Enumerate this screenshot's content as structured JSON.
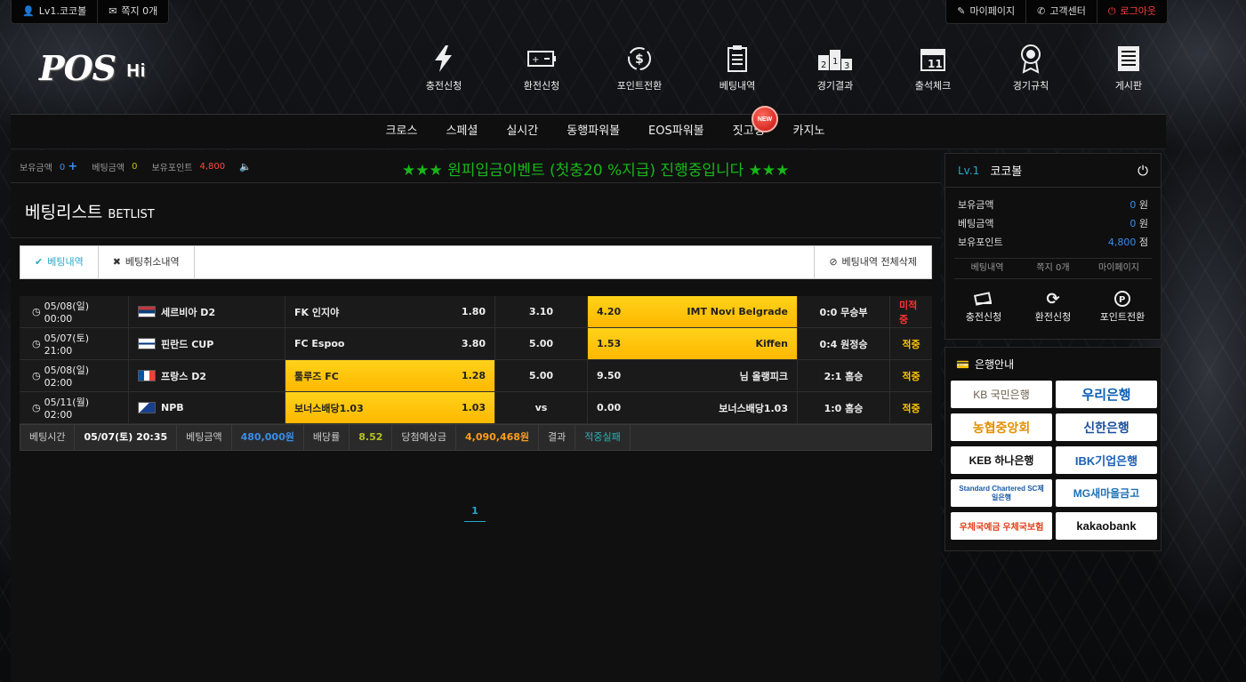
{
  "topbar": {
    "user": "Lv1.코코볼",
    "messages": "쪽지 0개",
    "mypage": "마이페이지",
    "support": "고객센터",
    "logout": "로그아웃"
  },
  "logo": {
    "main": "POS",
    "sub": "Hi"
  },
  "mainnav": [
    {
      "label": "충전신청",
      "icon": "lightning-icon"
    },
    {
      "label": "환전신청",
      "icon": "battery-icon"
    },
    {
      "label": "포인트전환",
      "icon": "dollar-cycle-icon"
    },
    {
      "label": "베팅내역",
      "icon": "clipboard-icon"
    },
    {
      "label": "경기결과",
      "icon": "podium-icon"
    },
    {
      "label": "출석체크",
      "icon": "calendar-icon"
    },
    {
      "label": "경기규칙",
      "icon": "award-icon"
    },
    {
      "label": "게시판",
      "icon": "document-icon"
    }
  ],
  "submenu": [
    "크로스",
    "스페셜",
    "실시간",
    "동행파워볼",
    "EOS파워볼",
    "짓고땡",
    "카지노"
  ],
  "new_badge": "NEW",
  "status": {
    "balance_label": "보유금액",
    "balance": "0",
    "bet_label": "베팅금액",
    "bet": "0",
    "point_label": "보유포인트",
    "point": "4,800"
  },
  "marquee": "★★★ 원피입금이벤트 (첫충20 %지급) 진행중입니다 ★★★",
  "page": {
    "title": "베팅리스트",
    "title_en": "BETLIST"
  },
  "tabs": {
    "history": "베팅내역",
    "cancel": "베팅취소내역",
    "delete_all": "베팅내역 전체삭제"
  },
  "bets": [
    {
      "date": "05/08(일) 00:00",
      "league": "세르비아 D2",
      "home": "FK 인지야",
      "home_odds": "1.80",
      "draw": "3.10",
      "away_odds": "4.20",
      "away": "IMT Novi Belgrade",
      "score": "0:0 무승부",
      "result": "미적중",
      "selected": "away"
    },
    {
      "date": "05/07(토) 21:00",
      "league": "핀란드 CUP",
      "home": "FC Espoo",
      "home_odds": "3.80",
      "draw": "5.00",
      "away_odds": "1.53",
      "away": "Kiffen",
      "score": "0:4 원정승",
      "result": "적중",
      "selected": "away"
    },
    {
      "date": "05/08(일) 02:00",
      "league": "프랑스 D2",
      "home": "툴루즈 FC",
      "home_odds": "1.28",
      "draw": "5.00",
      "away_odds": "9.50",
      "away": "님 올랭피크",
      "score": "2:1 홈승",
      "result": "적중",
      "selected": "home"
    },
    {
      "date": "05/11(월) 02:00",
      "league": "NPB",
      "home": "보너스배당1.03",
      "home_odds": "1.03",
      "draw": "vs",
      "away_odds": "0.00",
      "away": "보너스배당1.03",
      "score": "1:0 홈승",
      "result": "적중",
      "selected": "home"
    }
  ],
  "summary": {
    "time_label": "베팅시간",
    "time": "05/07(토) 20:35",
    "amount_label": "베팅금액",
    "amount": "480,000원",
    "rate_label": "배당률",
    "rate": "8.52",
    "win_label": "당첨예상금",
    "win": "4,090,468원",
    "result_label": "결과",
    "result": "적중실패"
  },
  "pager": "1",
  "user_panel": {
    "level": "Lv.1",
    "name": "코코볼",
    "balance_label": "보유금액",
    "balance": "0",
    "won": "원",
    "bet_label": "베팅금액",
    "bet": "0",
    "point_label": "보유포인트",
    "point": "4,800",
    "point_unit": "점",
    "tabs": [
      "베팅내역",
      "쪽지 0개",
      "마이페이지"
    ],
    "actions": [
      "충전신청",
      "환전신청",
      "포인트전환"
    ]
  },
  "bank": {
    "title": "은행안내",
    "banks": [
      "KB 국민은행",
      "우리은행",
      "농협중앙회",
      "신한은행",
      "KEB 하나은행",
      "IBK기업은행",
      "Standard Chartered SC제일은행",
      "MG새마을금고",
      "우체국예금 우체국보험",
      "kakaobank"
    ]
  }
}
